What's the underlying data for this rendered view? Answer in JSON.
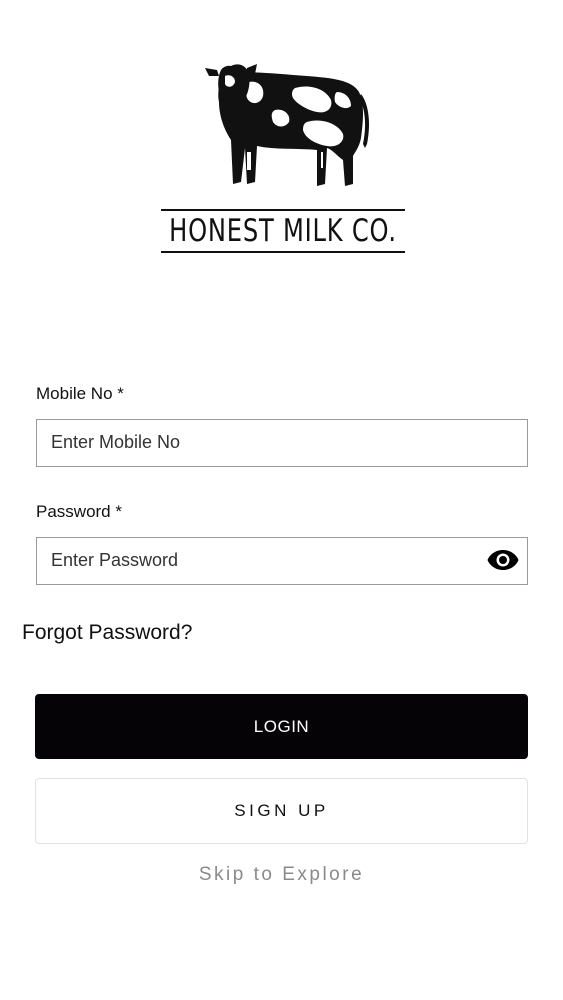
{
  "brand": {
    "logo_icon": "cow-icon",
    "name": "HONEST MILK CO."
  },
  "form": {
    "mobile": {
      "label": "Mobile No *",
      "placeholder": "Enter Mobile No",
      "value": ""
    },
    "password": {
      "label": "Password *",
      "placeholder": "Enter Password",
      "value": "",
      "toggle_icon": "eye-icon"
    },
    "forgot_password": "Forgot Password?"
  },
  "actions": {
    "login": "LOGIN",
    "signup": "SIGN UP",
    "skip": "Skip to Explore"
  },
  "colors": {
    "primary_button": "#050306",
    "skip_text": "#8a8a8a",
    "input_border": "#9a9a9a"
  }
}
